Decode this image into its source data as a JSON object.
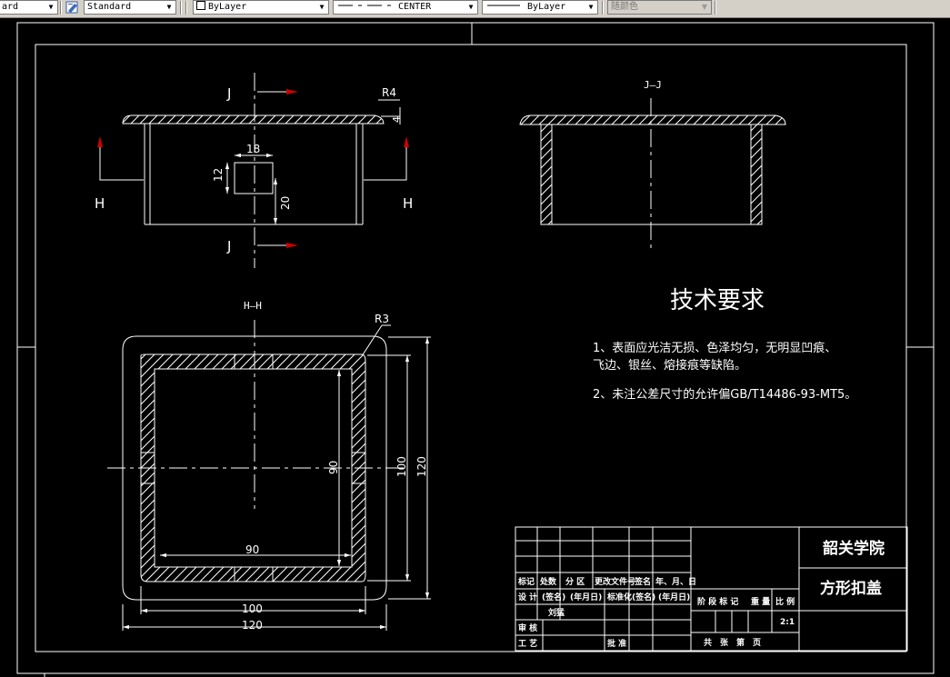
{
  "toolbar": {
    "style_fragment": "ard",
    "text_style": "Standard",
    "layer": "ByLayer",
    "linetype": "CENTER",
    "lineweight": "ByLayer",
    "color": "随颜色"
  },
  "drawing": {
    "front_view": {
      "cut_top": "J",
      "cut_bottom": "J",
      "cut_left": "H",
      "cut_right": "H",
      "dim_radius": "R4",
      "dim_thickness": "4",
      "dim_hole_width": "18",
      "dim_hole_height": "12",
      "dim_hole_offset": "20"
    },
    "section_jj": {
      "label": "J—J"
    },
    "section_hh": {
      "label": "H—H",
      "dim_radius": "R3",
      "dim_inner_w": "90",
      "dim_inner_h": "90",
      "dim_mid_w": "100",
      "dim_mid_h": "100",
      "dim_outer_w": "120",
      "dim_outer_h": "120"
    },
    "notes": {
      "title": "技术要求",
      "line1": "1、表面应光洁无损、色泽均匀，无明显凹痕、",
      "line2": "飞边、银丝、熔接痕等缺陷。",
      "line3": "2、未注公差尺寸的允许偏GB/T14486-93-MT5。"
    },
    "title_block": {
      "school": "韶关学院",
      "part_name": "方形扣盖",
      "h_mark": "标记",
      "h_count": "处数",
      "h_zone": "分 区",
      "h_docno": "更改文件号",
      "h_sign": "签名",
      "h_date": "年、月、日",
      "r_design": "设 计",
      "r_sign1": "(签名)",
      "r_date1": "(年月日)",
      "r_std": "标准化",
      "r_sign2": "(签名)",
      "r_date2": "(年月日)",
      "designer": "刘猛",
      "r_review": "审 核",
      "r_process": "工 艺",
      "r_approve": "批 准",
      "h_stage": "阶 段 标 记",
      "h_weight": "重 量",
      "h_scale": "比 例",
      "scale": "2:1",
      "h_sheets": "共　张　第　页"
    }
  }
}
